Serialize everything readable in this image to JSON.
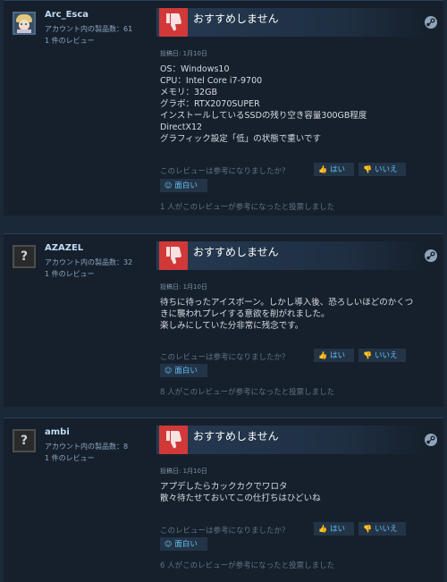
{
  "verdict_label": "おすすめしません",
  "helpful_question": "このレビューは参考になりましたか？",
  "yes_label": "はい",
  "no_label": "いいえ",
  "funny_label": "面白い",
  "colors": {
    "thumb_down": "#d13939",
    "link": "#66c0f4",
    "name": "#c1dbf4"
  },
  "reviews": [
    {
      "author": "Arc_Esca",
      "avatar": "anime-avatar",
      "products": "アカウント内の製品数：61",
      "review_count": "1 件のレビュー",
      "posted": "投稿日: 1月10日",
      "lines": [
        "OS：Windows10",
        "CPU：Intel Core i7-9700",
        "メモリ：32GB",
        "グラボ：RTX2070SUPER",
        "インストールしているSSDの残り空き容量300GB程度",
        "DirectX12",
        "グラフィック設定「低」の状態で重いです"
      ],
      "tally": "1 人がこのレビューが参考になったと投票しました"
    },
    {
      "author": "AZAZEL",
      "avatar": "question-mark",
      "products": "アカウント内の製品数：32",
      "review_count": "1 件のレビュー",
      "posted": "投稿日: 1月10日",
      "lines": [
        "待ちに待ったアイスボーン。しかし導入後、恐ろしいほどのかくつ",
        "きに襲われプレイする意欲を削がれました。",
        "楽しみにしていた分非常に残念です。"
      ],
      "tally": "8 人がこのレビューが参考になったと投票しました"
    },
    {
      "author": "ambi",
      "avatar": "question-mark",
      "products": "アカウント内の製品数：8",
      "review_count": "1 件のレビュー",
      "posted": "投稿日: 1月10日",
      "lines": [
        "アプデしたらカックカクでワロタ",
        "散々待たせておいてこの仕打ちはひどいね"
      ],
      "tally": "6 人がこのレビューが参考になったと投票しました"
    }
  ]
}
